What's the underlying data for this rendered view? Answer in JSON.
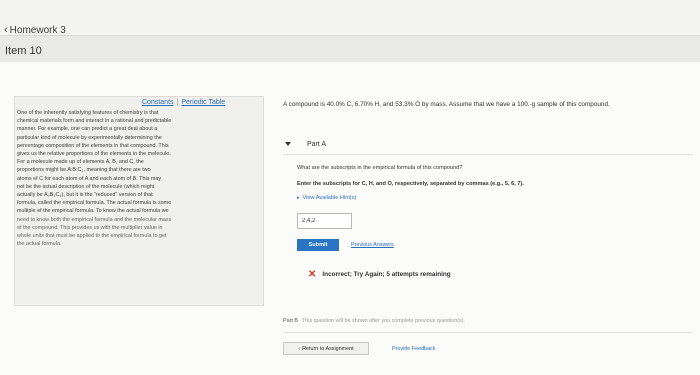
{
  "header": {
    "back_chevron": "‹",
    "back_label": "Homework 3"
  },
  "item": {
    "title": "Item 10"
  },
  "resources": {
    "constants": "Constants",
    "separator": "|",
    "periodic_table": "Periodic Table"
  },
  "intro": {
    "lines": [
      "One of the inherently satisfying features of chemistry is that",
      "chemical materials form and interact in a rational and predictable",
      "manner. For example, one can predict a great deal about a",
      "particular kind of molecule by experimentally determining the",
      "percentage composition of the elements in that compound. This",
      "gives us the relative proportions of the elements in the molecule.",
      "For a molecule made up of elements A, B, and C, the",
      "proportions might be A:B:C₂, meaning that there are two",
      "atoms of C for each atom of A and each atom of B. This may",
      "not be the actual description of the molecule (which might",
      "actually be A₃B₃C₆), but it is the \"reduced\" version of that",
      "formula, called the empirical formula. The actual formula is some",
      "multiple of the empirical formula. To know the actual formula we",
      "need to know both the empirical formula and the molecular mass",
      "of the compound. This provides us with the multiplier value in",
      "whole units that must be applied to the empirical formula to get",
      "the actual formula."
    ]
  },
  "question": {
    "stem": "A compound is 40.0% C, 6.70% H, and 53.3% O by mass. Assume that we have a 100.-g sample of this compound."
  },
  "part_a": {
    "label": "Part A",
    "question": "What are the subscripts in the empirical formula of this compound?",
    "instruction": "Enter the subscripts for C, H, and O, respectively, separated by commas (e.g., 5, 6, 7).",
    "hints_label": "View Available Hint(s)",
    "answer_value": "2,4,2",
    "submit_label": "Submit",
    "previous_answers": "Previous Answers",
    "feedback_icon": "✕",
    "feedback_text": "Incorrect; Try Again; 5 attempts remaining"
  },
  "part_b": {
    "label": "Part B",
    "note": "This question will be shown after you complete previous question(s)."
  },
  "footer": {
    "return_chevron": "‹",
    "return_label": "Return to Assignment",
    "provide_feedback": "Provide Feedback"
  }
}
